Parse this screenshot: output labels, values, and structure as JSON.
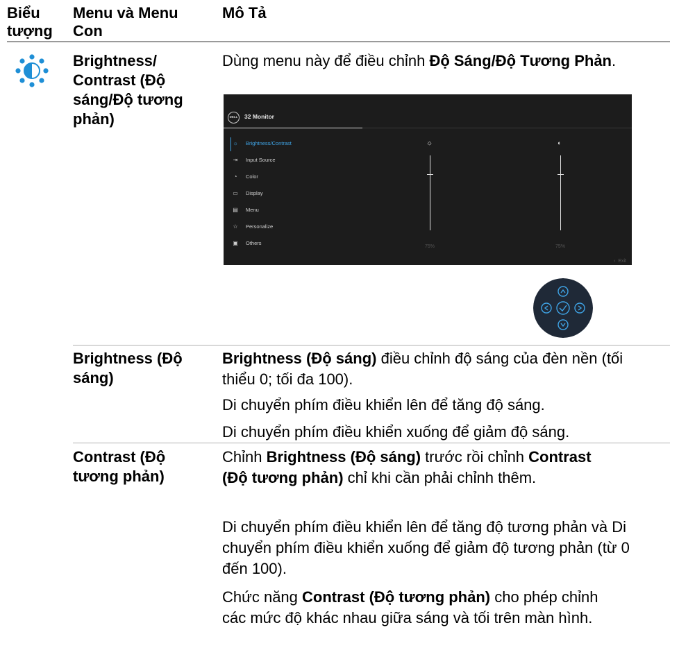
{
  "header": {
    "col_icon": "Biểu tượng",
    "col_menu": "Menu và Menu Con",
    "col_desc": "Mô Tả"
  },
  "colors": {
    "osd_bg": "#1c1c1c",
    "accent": "#3fa4e6",
    "icon_blue": "#1f8fd6",
    "rule": "#9a9a9a"
  },
  "row1": {
    "icon": "brightness-contrast-icon",
    "menu": "Brightness/ Contrast (Độ sáng/Độ tương phản)",
    "desc_pre": "Dùng menu này để điều chỉnh ",
    "desc_bold": "Độ Sáng/Độ Tương Phản",
    "desc_post": "."
  },
  "osd": {
    "logo": "DELL",
    "title": "32 Monitor",
    "items": [
      {
        "label": "Brightness/Contrast",
        "icon": "sun-icon",
        "selected": true
      },
      {
        "label": "Input Source",
        "icon": "input-icon"
      },
      {
        "label": "Color",
        "icon": "palette-icon"
      },
      {
        "label": "Display",
        "icon": "monitor-icon"
      },
      {
        "label": "Menu",
        "icon": "menu-icon"
      },
      {
        "label": "Personalize",
        "icon": "star-icon"
      },
      {
        "label": "Others",
        "icon": "others-icon"
      }
    ],
    "brightness_pct": "75%",
    "contrast_pct": "75%",
    "brightness_value": 0.75,
    "contrast_value": 0.75,
    "exit": "Exit"
  },
  "row2": {
    "menu": "Brightness (Độ sáng)",
    "p1_bold": "Brightness (Độ sáng)",
    "p1_rest": " điều chỉnh độ sáng của đèn nền (tối thiểu 0; tối đa 100).",
    "p2": "Di chuyển phím điều khiển lên để tăng độ sáng.",
    "p3": "Di chuyển phím điều khiển xuống để giảm độ sáng."
  },
  "row3": {
    "menu": "Contrast (Độ tương phản)",
    "p1_a": "Chỉnh ",
    "p1_b": "Brightness (Độ sáng)",
    "p1_c": " trước rồi chỉnh ",
    "p1_d": "Contrast (Độ tương phản)",
    "p1_e": " chỉ khi cần phải chỉnh thêm.",
    "p2": "Di chuyển phím điều khiển lên để tăng độ tương phản và Di chuyển phím điều khiển xuống để giảm độ tương phản (từ 0 đến 100).",
    "p3_a": "Chức năng ",
    "p3_b": "Contrast (Độ tương phản)",
    "p3_c": " cho phép chỉnh các mức độ khác nhau giữa sáng và tối trên màn hình."
  }
}
